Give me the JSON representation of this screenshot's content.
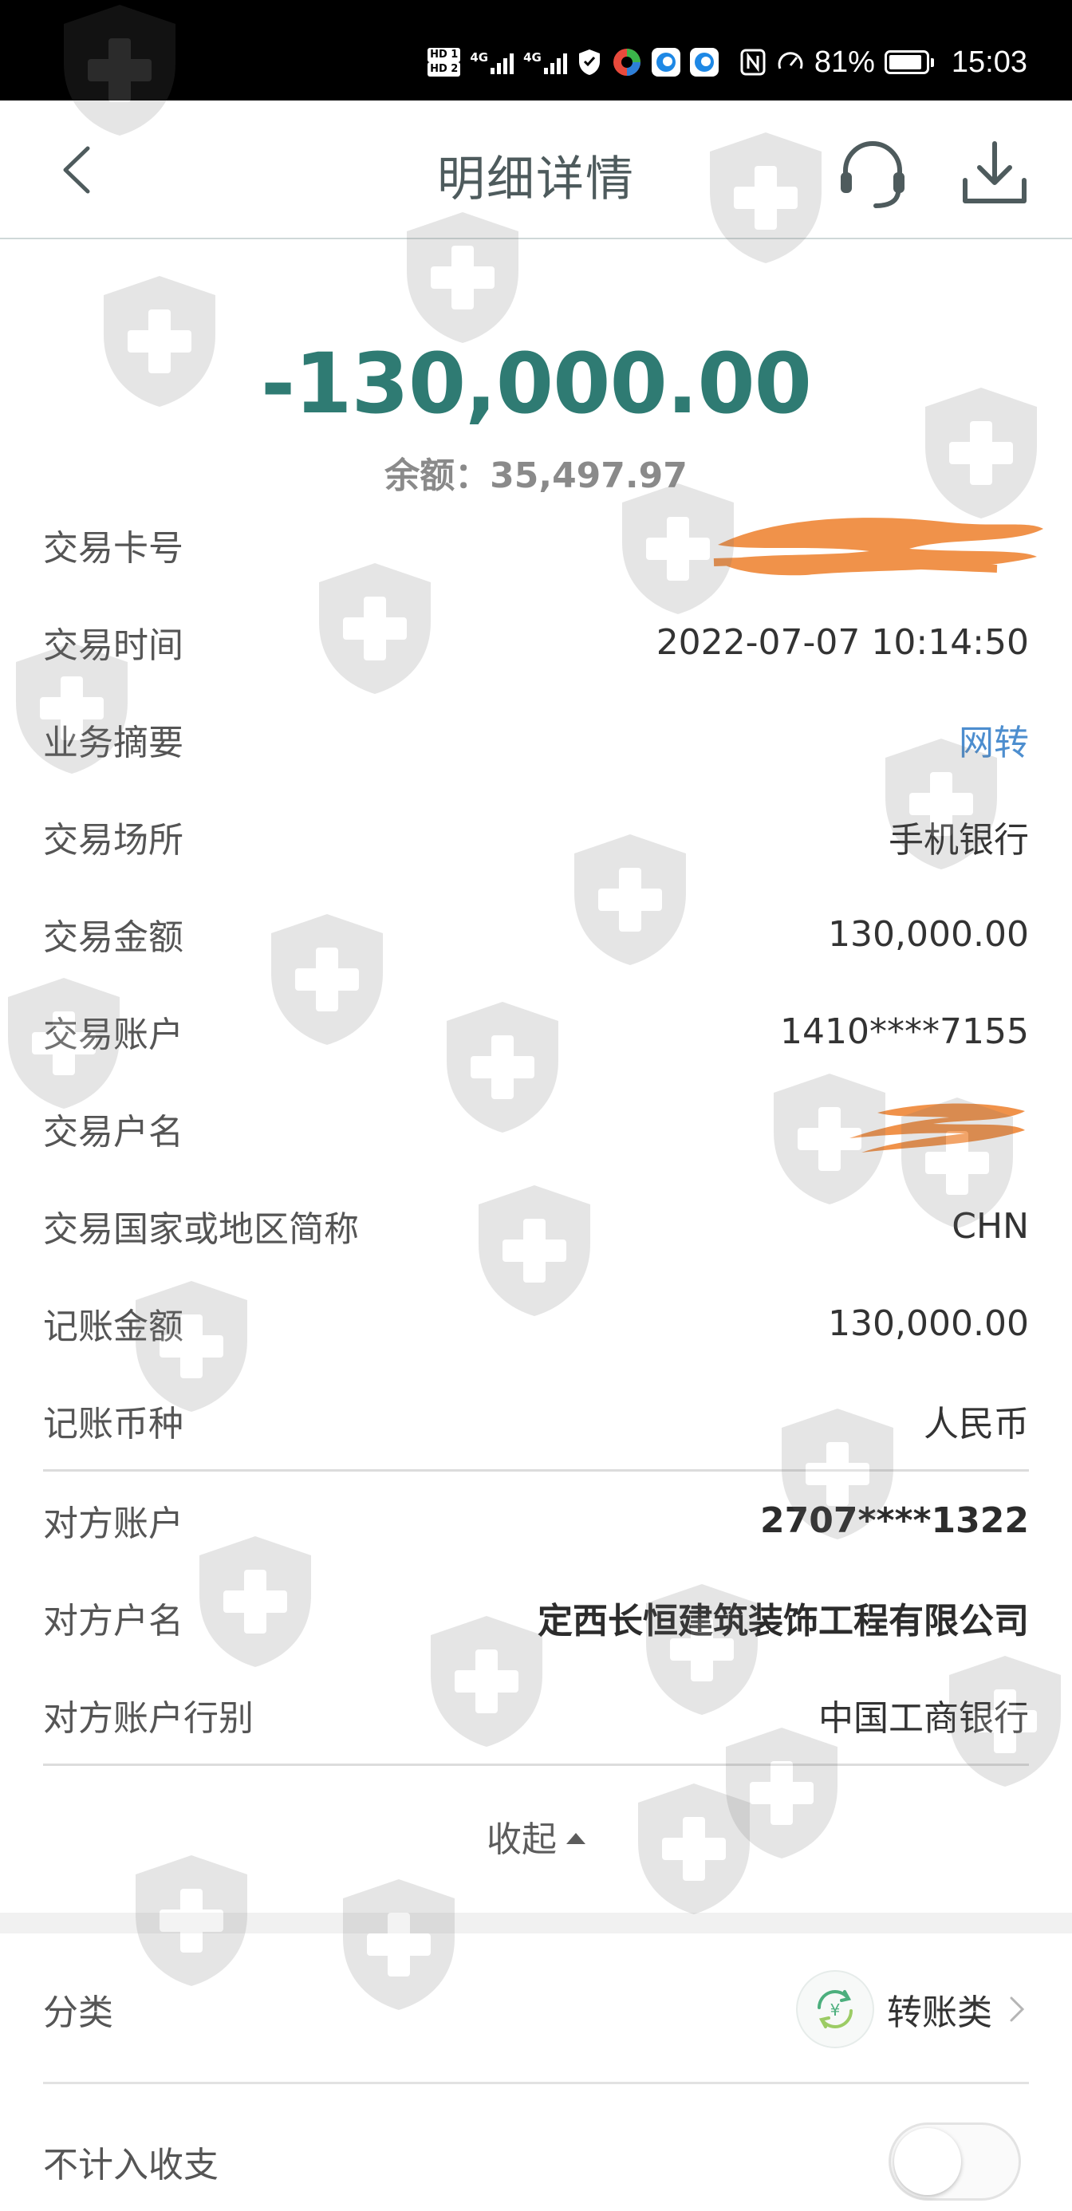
{
  "status_bar": {
    "hd1": "HD 1",
    "hd2": "HD 2",
    "net1": "4G",
    "net2": "4G",
    "battery_percent": "81%",
    "time": "15:03"
  },
  "nav": {
    "title": "明细详情",
    "back_icon": "chevron-left-icon",
    "service_icon": "headset-icon",
    "download_icon": "download-icon"
  },
  "transaction": {
    "amount": "-130,000.00",
    "balance": "余额：35,497.97",
    "amount_color": "#2f7b73"
  },
  "details": [
    {
      "label": "交易卡号",
      "value": "",
      "redacted": true
    },
    {
      "label": "交易时间",
      "value": "2022-07-07 10:14:50"
    },
    {
      "label": "业务摘要",
      "value": "网转",
      "link": true
    },
    {
      "label": "交易场所",
      "value": "手机银行"
    },
    {
      "label": "交易金额",
      "value": "130,000.00"
    },
    {
      "label": "交易账户",
      "value": "1410****7155"
    },
    {
      "label": "交易户名",
      "value": "",
      "redacted": true
    },
    {
      "label": "交易国家或地区简称",
      "value": "CHN"
    },
    {
      "label": "记账金额",
      "value": "130,000.00"
    },
    {
      "label": "记账币种",
      "value": "人民币"
    }
  ],
  "counterparty": [
    {
      "label": "对方账户",
      "value": "2707****1322"
    },
    {
      "label": "对方户名",
      "value": "定西长恒建筑装饰工程有限公司"
    },
    {
      "label": "对方账户行别",
      "value": "中国工商银行"
    }
  ],
  "collapse_label": "收起",
  "category": {
    "label": "分类",
    "value": "转账类",
    "icon": "yuan-transfer-icon"
  },
  "exclude": {
    "label": "不计入收支",
    "enabled": false
  },
  "colors": {
    "accent": "#2f7b73",
    "link": "#4d8ecf",
    "redaction": "#f0924a"
  }
}
